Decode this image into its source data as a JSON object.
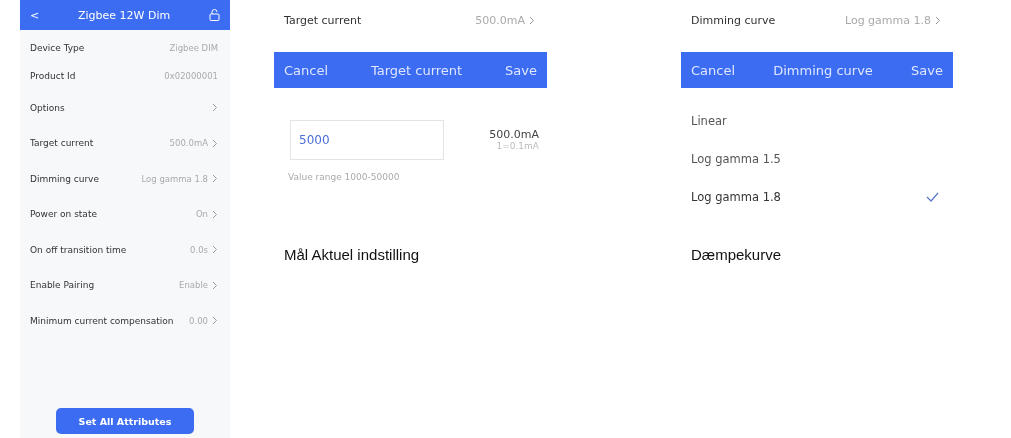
{
  "device_screen": {
    "header": {
      "back": "<",
      "title": "Zigbee 12W Dim"
    },
    "rows": [
      {
        "kind": "info",
        "label": "Device Type",
        "value": "Zigbee DIM"
      },
      {
        "kind": "info",
        "label": "Product Id",
        "value": "0x02000001"
      },
      {
        "kind": "nav",
        "label": "Options",
        "value": ""
      },
      {
        "kind": "nav",
        "label": "Target current",
        "value": "500.0mA"
      },
      {
        "kind": "nav",
        "label": "Dimming curve",
        "value": "Log gamma 1.8"
      },
      {
        "kind": "nav",
        "label": "Power on state",
        "value": "On"
      },
      {
        "kind": "nav",
        "label": "On off transition time",
        "value": "0.0s"
      },
      {
        "kind": "nav",
        "label": "Enable Pairing",
        "value": "Enable"
      },
      {
        "kind": "nav",
        "label": "Minimum current compensation",
        "value": "0.00"
      }
    ],
    "button": "Set All Attributes"
  },
  "target_current_screen": {
    "row": {
      "label": "Target current",
      "value": "500.0mA"
    },
    "dialog": {
      "cancel": "Cancel",
      "title": "Target current",
      "save": "Save",
      "input_value": "5000",
      "reading": "500.0mA",
      "unit_note": "1=0.1mA",
      "range_hint": "Value range 1000-50000"
    },
    "caption": "Mål Aktuel indstilling"
  },
  "dimming_curve_screen": {
    "row": {
      "label": "Dimming curve",
      "value": "Log gamma 1.8"
    },
    "dialog": {
      "cancel": "Cancel",
      "title": "Dimming curve",
      "save": "Save"
    },
    "options": [
      {
        "label": "Linear",
        "selected": false
      },
      {
        "label": "Log gamma 1.5",
        "selected": false
      },
      {
        "label": "Log gamma 1.8",
        "selected": true
      }
    ],
    "caption": "Dæmpekurve"
  }
}
